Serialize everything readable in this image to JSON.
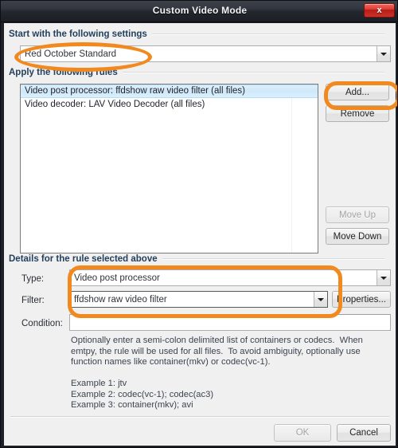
{
  "window": {
    "title": "Custom Video Mode",
    "close_label": "x"
  },
  "groups": {
    "start_settings": "Start with the following settings",
    "apply_rules": "Apply the following rules",
    "details": "Details for the rule selected above"
  },
  "preset_combo": {
    "value": "Red October Standard",
    "placeholder": ""
  },
  "rules_list": {
    "items": [
      {
        "label": "Video post processor: ffdshow raw video filter (all files)",
        "selected": true
      },
      {
        "label": "Video decoder: LAV Video Decoder (all files)",
        "selected": false
      }
    ]
  },
  "side_buttons": {
    "add": "Add...",
    "remove": "Remove",
    "move_up": "Move Up",
    "move_down": "Move Down"
  },
  "details": {
    "type_label": "Type:",
    "type_value": "Video post processor",
    "filter_label": "Filter:",
    "filter_value": "ffdshow raw video filter",
    "properties_button": "Properties...",
    "condition_label": "Condition:",
    "condition_value": "",
    "help_paragraph": "Optionally enter a semi-colon delimited list of containers or codecs.  When\nemtpy, the rule will be used for all files.  To avoid ambiguity, optionally use\nfunction names like container(mkv) or codec(vc-1).",
    "examples": "Example 1: jtv\nExample 2: codec(vc-1); codec(ac3)\nExample 3: container(mkv); avi"
  },
  "footer": {
    "ok": "OK",
    "cancel": "Cancel"
  },
  "colors": {
    "annotation": "#f2891e",
    "title_bar": "#2b2f37",
    "close_button": "#c9332b",
    "group_label": "#24405c",
    "selection": "#cfe8fa"
  }
}
